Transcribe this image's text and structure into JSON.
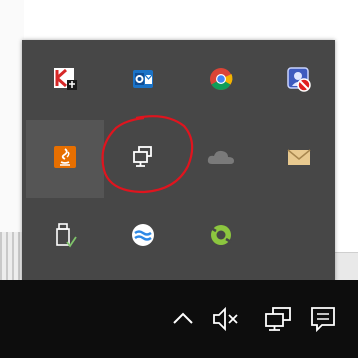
{
  "tray": {
    "items": [
      {
        "name": "kaspersky",
        "icon": "kaspersky-icon",
        "color": "#d62828"
      },
      {
        "name": "outlook",
        "icon": "outlook-icon",
        "color": "#1b73c7"
      },
      {
        "name": "chrome",
        "icon": "chrome-icon",
        "color": "#db4437"
      },
      {
        "name": "security-shield",
        "icon": "shield-blocked-icon",
        "color": "#3e5bbf"
      },
      {
        "name": "java-update",
        "icon": "java-icon",
        "color": "#e76f00"
      },
      {
        "name": "network-disconnected",
        "icon": "network-monitor-icon",
        "color": "#ffffff"
      },
      {
        "name": "onedrive",
        "icon": "cloud-icon",
        "color": "#7a7a7a"
      },
      {
        "name": "mail",
        "icon": "envelope-icon",
        "color": "#e8c98f"
      },
      {
        "name": "usb-safely-remove",
        "icon": "usb-drive-icon",
        "color": "#ffffff"
      },
      {
        "name": "teamviewer-like",
        "icon": "waves-icon",
        "color": "#2f8ae6"
      },
      {
        "name": "green-app",
        "icon": "green-leaf-icon",
        "color": "#8cc63f"
      }
    ]
  },
  "taskbar": {
    "icons": [
      {
        "name": "show-hidden-icons",
        "icon": "chevron-up-icon"
      },
      {
        "name": "volume-muted",
        "icon": "speaker-muted-icon"
      },
      {
        "name": "network",
        "icon": "network-icon"
      },
      {
        "name": "action-center",
        "icon": "notification-icon"
      }
    ]
  },
  "annotation": {
    "color": "#e0141e"
  }
}
